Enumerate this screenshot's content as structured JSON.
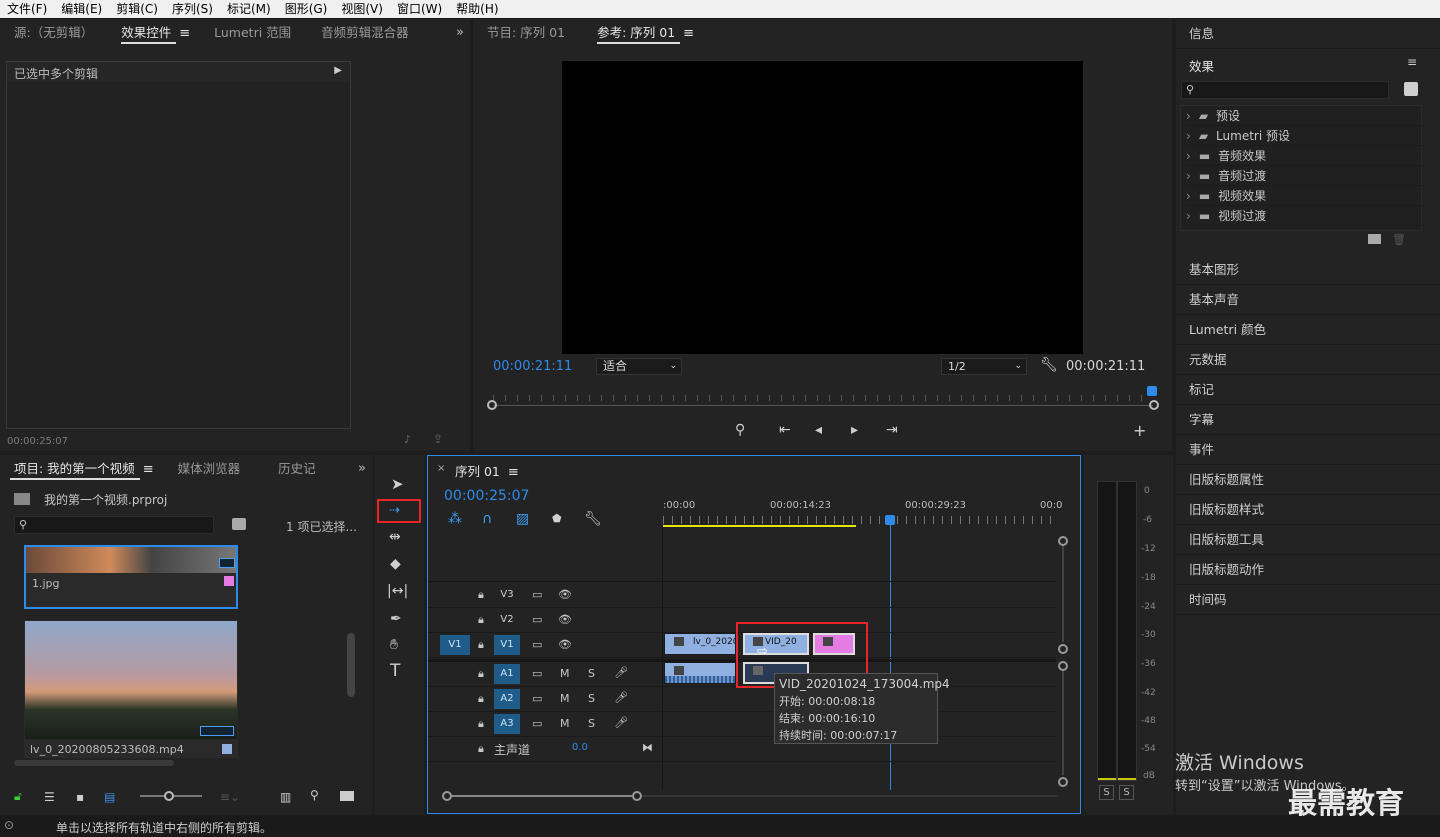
{
  "menu": [
    "文件(F)",
    "编辑(E)",
    "剪辑(C)",
    "序列(S)",
    "标记(M)",
    "图形(G)",
    "视图(V)",
    "窗口(W)",
    "帮助(H)"
  ],
  "source_panel": {
    "tabs": [
      "源:（无剪辑）",
      "效果控件",
      "Lumetri 范围",
      "音频剪辑混合器"
    ],
    "active_tab": "效果控件",
    "message": "已选中多个剪辑",
    "timecode": "00:00:25:07"
  },
  "program_panel": {
    "tabs": [
      "节目: 序列 01",
      "参考: 序列 01"
    ],
    "timecode_left": "00:00:21:11",
    "fit": "适合",
    "resolution": "1/2",
    "timecode_right": "00:00:21:11"
  },
  "project_panel": {
    "tabs": [
      "项目: 我的第一个视频",
      "媒体浏览器",
      "历史记"
    ],
    "file": "我的第一个视频.prproj",
    "selection": "1 项已选择...",
    "items": [
      "1.jpg",
      "lv_0_20200805233608.mp4"
    ]
  },
  "timeline": {
    "tab": "序列 01",
    "timecode": "00:00:25:07",
    "ruler": [
      ":00:00",
      "00:00:14:23",
      "00:00:29:23",
      "00:0"
    ],
    "video_tracks": [
      "V3",
      "V2",
      "V1"
    ],
    "audio_tracks": [
      "A1",
      "A2",
      "A3"
    ],
    "source_patch": "V1",
    "mix_label": "主声道",
    "mix_value": "0.0",
    "clips": {
      "v1a": "lv_0_2020",
      "v1b": "VID_20"
    },
    "tooltip": {
      "name": "VID_20201024_173004.mp4",
      "start": "开始: 00:00:08:18",
      "end": "结束: 00:00:16:10",
      "duration": "持续时间: 00:00:07:17"
    }
  },
  "meter": {
    "labels": [
      "0",
      "-6",
      "-12",
      "-18",
      "-24",
      "-30",
      "-36",
      "-42",
      "-48",
      "-54",
      "dB"
    ],
    "solo": [
      "S",
      "S"
    ]
  },
  "right_panel": {
    "info": "信息",
    "effects_title": "效果",
    "effects_tree": [
      "预设",
      "Lumetri 预设",
      "音频效果",
      "音频过渡",
      "视频效果",
      "视频过渡"
    ],
    "sections": [
      "基本图形",
      "基本声音",
      "Lumetri 颜色",
      "元数据",
      "标记",
      "字幕",
      "事件",
      "旧版标题属性",
      "旧版标题样式",
      "旧版标题工具",
      "旧版标题动作",
      "时间码"
    ]
  },
  "watermark": {
    "line1": "激活 Windows",
    "line2": "转到“设置”以激活 Windows。",
    "brand": "最需教育"
  },
  "status_text": "单击以选择所有轨道中右侧的所有剪辑。"
}
